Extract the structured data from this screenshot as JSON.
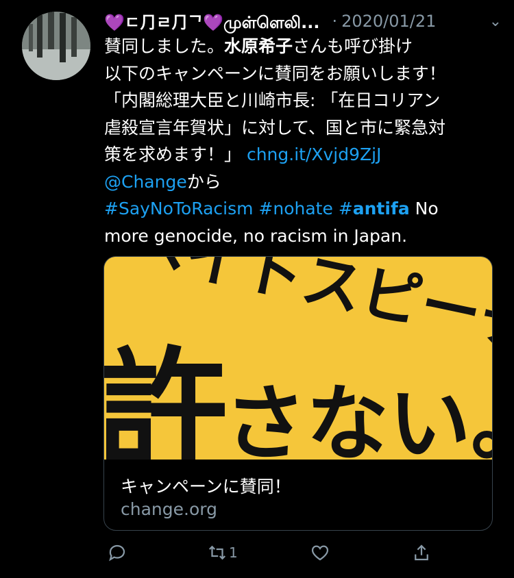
{
  "tweet": {
    "display_name": "💜ㄷ⺆ㄹ⺆ᄀ💜முள்ளெலி...",
    "separator": "·",
    "date": "2020/01/21",
    "caret": "⌄",
    "line1_a": "賛同しました。",
    "line1_bold": "水原希子",
    "line1_b": "さんも呼び掛け",
    "line2": "以下のキャンペーンに賛同をお願いします！",
    "line3": "「内閣総理大臣と川崎市長: 「在日コリアン",
    "line4": "虐殺宣言年賀状」に対して、国と市に緊急対",
    "line5_a": "策を求めます！」 ",
    "link": "chng.it/Xvjd9ZjJ",
    "mention": "@Change",
    "mention_suffix": "から",
    "hashtag1": "#SayNoToRacism",
    "hashtag2": "#nohate",
    "hashtag3_prefix": "#",
    "hashtag3_bold": "antifa",
    "tail1": " No",
    "tail2": "more genocide, no  racism in Japan."
  },
  "card": {
    "image_text_top": "ヘイトスピーチ、",
    "image_text_big": "許",
    "image_text_bottom": "さない。",
    "title": "キャンペーンに賛同！",
    "domain": "change.org"
  },
  "actions": {
    "retweet_count": "1"
  },
  "colors": {
    "background": "#000000",
    "link": "#1da1f2",
    "muted": "#8899a6",
    "card_bg": "#f5c63a"
  }
}
